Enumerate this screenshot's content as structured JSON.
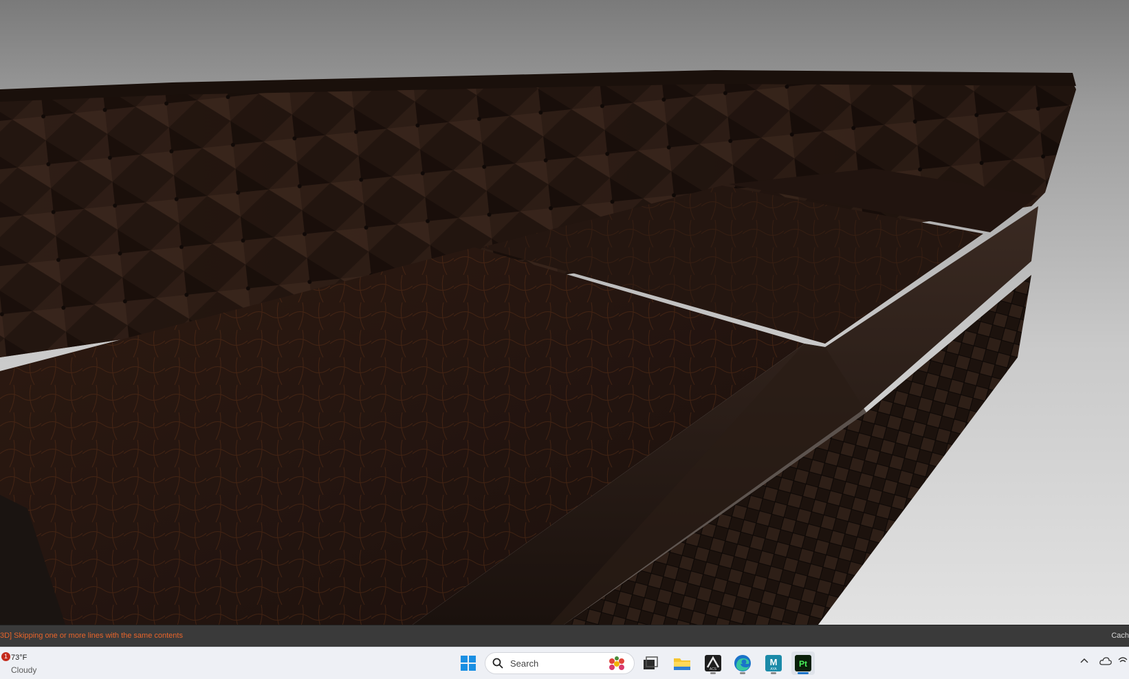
{
  "statusbar": {
    "message": "3D] Skipping one or more lines with the same contents",
    "right_text": "Cach"
  },
  "taskbar": {
    "weather": {
      "badge": "1",
      "temp": "73°F",
      "condition": "Cloudy"
    },
    "search_placeholder": "Search",
    "apps": [
      {
        "name": "windows-start-icon"
      },
      {
        "name": "task-view-icon"
      },
      {
        "name": "file-explorer-icon"
      },
      {
        "name": "autodesk-icon",
        "label": "ACS"
      },
      {
        "name": "edge-browser-icon"
      },
      {
        "name": "maya-icon",
        "label": "M",
        "sublabel": "AYA"
      },
      {
        "name": "substance-painter-icon",
        "label": "Pt"
      }
    ],
    "tray": [
      "chevron-up-icon",
      "onedrive-cloud-icon",
      "network-icon"
    ]
  },
  "colors": {
    "status_text": "#e8642a",
    "leather": "#2a1a13",
    "taskbar": "#eef0f5",
    "painter_bg": "#0a1f0a",
    "painter_text": "#4af05a",
    "maya_bg": "#1b8aa8",
    "edge_blue": "#1a73c9"
  }
}
